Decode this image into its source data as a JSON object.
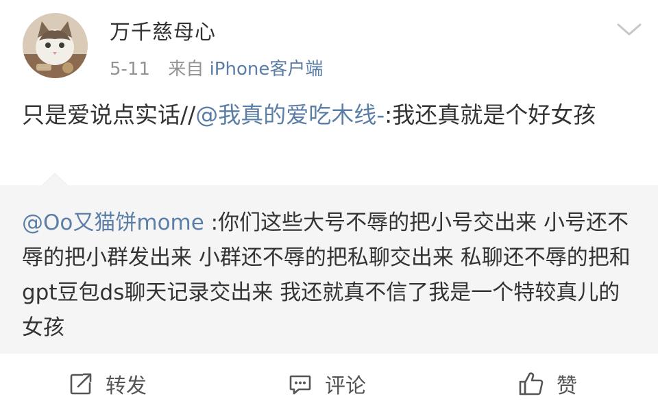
{
  "post": {
    "author": "万千慈母心",
    "date": "5-11",
    "source_prefix": "来自",
    "source_app": "iPhone客户端",
    "text_before": "只是爱说点实话//",
    "mention": "@我真的爱吃木线-",
    "text_after": ":我还真就是个好女孩"
  },
  "repost": {
    "mention": "@Oo又猫饼mome",
    "text": " :你们这些大号不辱的把小号交出来 小号还不辱的把小群发出来 小群还不辱的把私聊交出来 私聊还不辱的把和gpt豆包ds聊天记录交出来 我还就真不信了我是一个特较真儿的女孩"
  },
  "actions": {
    "repost_label": "转发",
    "comment_label": "评论",
    "like_label": "赞"
  },
  "icons": {
    "avatar": "cat-avatar-icon",
    "menu": "chevron-down-icon",
    "repost": "share-edit-icon",
    "comment": "comment-bubble-icon",
    "like": "thumbs-up-icon"
  },
  "colors": {
    "link": "#5b7ea6",
    "meta": "#939393",
    "repost_bg": "#f5f5f5"
  }
}
